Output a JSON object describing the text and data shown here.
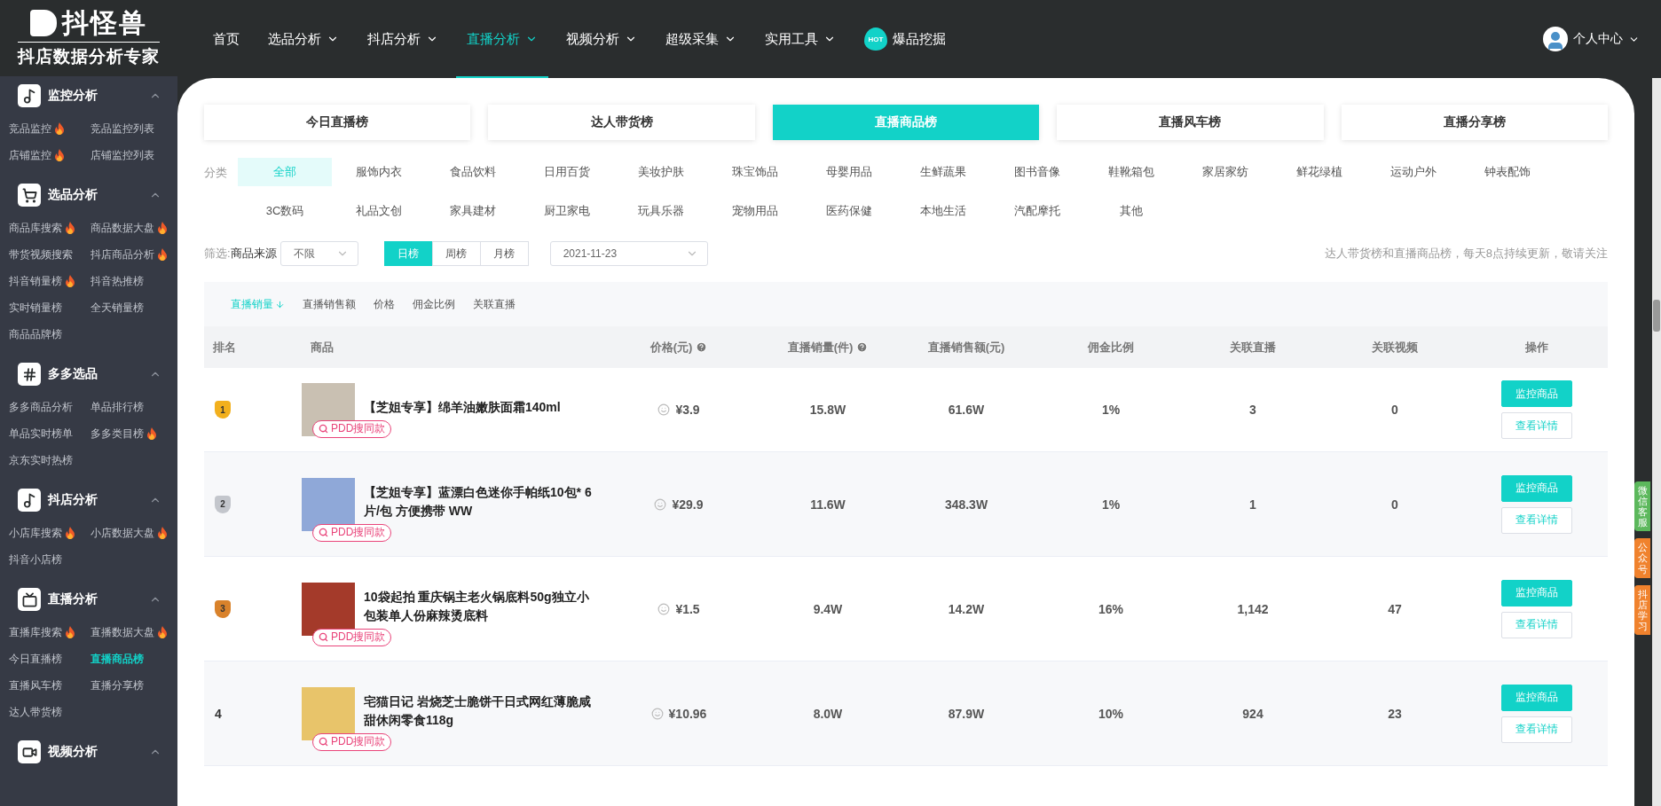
{
  "sidebar": {
    "logo": {
      "name": "抖怪兽",
      "slogan": "抖店数据分析专家"
    },
    "sections": [
      {
        "title": "监控分析",
        "expanded": true,
        "items": [
          {
            "label": "竞品监控",
            "hot": true,
            "selected": false
          },
          {
            "label": "竞品监控列表",
            "hot": false,
            "selected": false
          },
          {
            "label": "店铺监控",
            "hot": true,
            "selected": false
          },
          {
            "label": "店铺监控列表",
            "hot": false,
            "selected": false
          }
        ]
      },
      {
        "title": "选品分析",
        "expanded": true,
        "items": [
          {
            "label": "商品库搜索",
            "hot": true,
            "selected": false
          },
          {
            "label": "商品数据大盘",
            "hot": true,
            "selected": false
          },
          {
            "label": "带货视频搜索",
            "hot": false,
            "selected": false
          },
          {
            "label": "抖店商品分析",
            "hot": true,
            "selected": false
          },
          {
            "label": "抖音销量榜",
            "hot": true,
            "selected": false
          },
          {
            "label": "抖音热推榜",
            "hot": false,
            "selected": false
          },
          {
            "label": "实时销量榜",
            "hot": false,
            "selected": false
          },
          {
            "label": "全天销量榜",
            "hot": false,
            "selected": false
          },
          {
            "label": "商品品牌榜",
            "hot": false,
            "selected": false
          }
        ]
      },
      {
        "title": "多多选品",
        "expanded": true,
        "items": [
          {
            "label": "多多商品分析",
            "hot": false,
            "selected": false
          },
          {
            "label": "单品排行榜",
            "hot": false,
            "selected": false
          },
          {
            "label": "单品实时榜单",
            "hot": false,
            "selected": false
          },
          {
            "label": "多多类目榜",
            "hot": true,
            "selected": false
          },
          {
            "label": "京东实时热榜",
            "hot": false,
            "selected": false
          }
        ]
      },
      {
        "title": "抖店分析",
        "expanded": true,
        "items": [
          {
            "label": "小店库搜索",
            "hot": true,
            "selected": false
          },
          {
            "label": "小店数据大盘",
            "hot": true,
            "selected": false
          },
          {
            "label": "抖音小店榜",
            "hot": false,
            "selected": false
          }
        ]
      },
      {
        "title": "直播分析",
        "expanded": true,
        "items": [
          {
            "label": "直播库搜索",
            "hot": true,
            "selected": false
          },
          {
            "label": "直播数据大盘",
            "hot": true,
            "selected": false
          },
          {
            "label": "今日直播榜",
            "hot": false,
            "selected": false
          },
          {
            "label": "直播商品榜",
            "hot": false,
            "selected": true
          },
          {
            "label": "直播风车榜",
            "hot": false,
            "selected": false
          },
          {
            "label": "直播分享榜",
            "hot": false,
            "selected": false
          },
          {
            "label": "达人带货榜",
            "hot": false,
            "selected": false
          }
        ]
      },
      {
        "title": "视频分析",
        "expanded": true
      }
    ]
  },
  "nav": {
    "items": [
      {
        "kind": "link",
        "label": "首页",
        "selected": false
      },
      {
        "kind": "menu",
        "label": "选品分析",
        "selected": false
      },
      {
        "kind": "menu",
        "label": "抖店分析",
        "selected": false
      },
      {
        "kind": "menu",
        "label": "直播分析",
        "selected": true
      },
      {
        "kind": "menu",
        "label": "视频分析",
        "selected": false
      },
      {
        "kind": "menu",
        "label": "超级采集",
        "selected": false
      },
      {
        "kind": "menu",
        "label": "实用工具",
        "selected": false
      },
      {
        "kind": "hot",
        "label": "爆品挖掘",
        "badge": "HOT",
        "selected": false
      }
    ],
    "user": {
      "label": "个人中心"
    }
  },
  "tabs": [
    {
      "label": "今日直播榜",
      "selected": false
    },
    {
      "label": "达人带货榜",
      "selected": false
    },
    {
      "label": "直播商品榜",
      "selected": true
    },
    {
      "label": "直播风车榜",
      "selected": false
    },
    {
      "label": "直播分享榜",
      "selected": false
    }
  ],
  "categories": {
    "label": "分类",
    "options": [
      {
        "label": "全部",
        "selected": true
      },
      {
        "label": "服饰内衣",
        "selected": false
      },
      {
        "label": "食品饮料",
        "selected": false
      },
      {
        "label": "日用百货",
        "selected": false
      },
      {
        "label": "美妆护肤",
        "selected": false
      },
      {
        "label": "珠宝饰品",
        "selected": false
      },
      {
        "label": "母婴用品",
        "selected": false
      },
      {
        "label": "生鲜蔬果",
        "selected": false
      },
      {
        "label": "图书音像",
        "selected": false
      },
      {
        "label": "鞋靴箱包",
        "selected": false
      },
      {
        "label": "家居家纺",
        "selected": false
      },
      {
        "label": "鲜花绿植",
        "selected": false
      },
      {
        "label": "运动户外",
        "selected": false
      },
      {
        "label": "钟表配饰",
        "selected": false
      },
      {
        "label": "3C数码",
        "selected": false
      },
      {
        "label": "礼品文创",
        "selected": false
      },
      {
        "label": "家具建材",
        "selected": false
      },
      {
        "label": "厨卫家电",
        "selected": false
      },
      {
        "label": "玩具乐器",
        "selected": false
      },
      {
        "label": "宠物用品",
        "selected": false
      },
      {
        "label": "医药保健",
        "selected": false
      },
      {
        "label": "本地生活",
        "selected": false
      },
      {
        "label": "汽配摩托",
        "selected": false
      },
      {
        "label": "其他",
        "selected": false
      }
    ]
  },
  "filter": {
    "label": "筛选:",
    "source_label": "商品来源",
    "source_value": "不限",
    "periods": [
      {
        "label": "日榜",
        "selected": true
      },
      {
        "label": "周榜",
        "selected": false
      },
      {
        "label": "月榜",
        "selected": false
      }
    ],
    "date": "2021-11-23",
    "notice": "达人带货榜和直播商品榜，每天8点持续更新，敬请关注"
  },
  "sort": [
    {
      "label": "直播销量",
      "selected": true
    },
    {
      "label": "直播销售额",
      "selected": false
    },
    {
      "label": "价格",
      "selected": false
    },
    {
      "label": "佣金比例",
      "selected": false
    },
    {
      "label": "关联直播",
      "selected": false
    }
  ],
  "table": {
    "columns": [
      {
        "label": "排名",
        "help": false
      },
      {
        "label": "商品",
        "help": false
      },
      {
        "label": "价格(元)",
        "help": true
      },
      {
        "label": "直播销量(件)",
        "help": true
      },
      {
        "label": "直播销售额(元)",
        "help": false
      },
      {
        "label": "佣金比例",
        "help": false
      },
      {
        "label": "关联直播",
        "help": false
      },
      {
        "label": "关联视频",
        "help": false
      },
      {
        "label": "操作",
        "help": false
      }
    ],
    "rows": [
      {
        "rank": {
          "kind": "medal",
          "text": "1",
          "color": "#f2b01e"
        },
        "name": "【芝姐专享】绵羊油嫩肤面霜140ml",
        "search": "PDD搜同款",
        "price": "¥3.9",
        "sales": "15.8W",
        "revenue": "61.6W",
        "commission": "1%",
        "lives": "3",
        "videos": "0",
        "actions": [
          "监控商品",
          "查看详情"
        ]
      },
      {
        "rank": {
          "kind": "medal",
          "text": "2",
          "color": "#c3c6cc"
        },
        "name": "【芝姐专享】蓝漂白色迷你手帕纸10包* 6片/包 方便携带 WW",
        "search": "PDD搜同款",
        "price": "¥29.9",
        "sales": "11.6W",
        "revenue": "348.3W",
        "commission": "1%",
        "lives": "1",
        "videos": "0",
        "actions": [
          "监控商品",
          "查看详情"
        ]
      },
      {
        "rank": {
          "kind": "medal",
          "text": "3",
          "color": "#d9822b"
        },
        "name": "10袋起拍 重庆锅主老火锅底料50g独立小包装单人份麻辣烫底料",
        "search": "PDD搜同款",
        "price": "¥1.5",
        "sales": "9.4W",
        "revenue": "14.2W",
        "commission": "16%",
        "lives": "1,142",
        "videos": "47",
        "actions": [
          "监控商品",
          "查看详情"
        ]
      },
      {
        "rank": {
          "kind": "text",
          "text": "4"
        },
        "name": "宅猫日记 岩烧芝士脆饼干日式网红薄脆咸甜休闲零食118g",
        "search": "PDD搜同款",
        "price": "¥10.96",
        "sales": "8.0W",
        "revenue": "87.9W",
        "commission": "10%",
        "lives": "924",
        "videos": "23",
        "actions": [
          "监控商品",
          "查看详情"
        ]
      }
    ]
  },
  "side_tabs": [
    {
      "label": "微信客服",
      "color": "#5cb85c"
    },
    {
      "label": "公众号",
      "color": "#f0822d"
    },
    {
      "label": "抖店学习",
      "color": "#f0822d"
    }
  ]
}
